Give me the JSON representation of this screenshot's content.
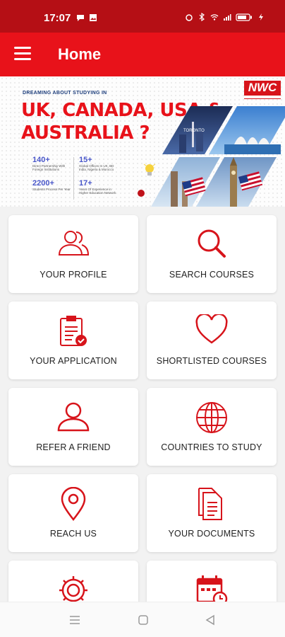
{
  "status": {
    "time": "17:07"
  },
  "header": {
    "title": "Home"
  },
  "banner": {
    "logo": "NWC",
    "tagline": "DREAMING ABOUT STUDYING IN",
    "headline_line1": "UK, CANADA, USA &",
    "headline_line2": "AUSTRALIA ?",
    "stats": [
      {
        "num": "140+",
        "label": "Direct Partnership With Foreign Institutions"
      },
      {
        "num": "15+",
        "label": "Global Offices In UK, BD India, Nigeria & Morocco"
      },
      {
        "num": "2200+",
        "label": "Students Process Per Year"
      },
      {
        "num": "17+",
        "label": "Years Of Experience in Higher Education Network"
      }
    ]
  },
  "menu": [
    {
      "label": "YOUR PROFILE",
      "icon": "users-icon"
    },
    {
      "label": "SEARCH COURSES",
      "icon": "search-icon"
    },
    {
      "label": "YOUR APPLICATION",
      "icon": "clipboard-check-icon"
    },
    {
      "label": "SHORTLISTED COURSES",
      "icon": "heart-icon"
    },
    {
      "label": "REFER A FRIEND",
      "icon": "user-icon"
    },
    {
      "label": "COUNTRIES TO STUDY",
      "icon": "globe-icon"
    },
    {
      "label": "REACH US",
      "icon": "location-pin-icon"
    },
    {
      "label": "YOUR DOCUMENTS",
      "icon": "documents-icon"
    },
    {
      "label": "",
      "icon": "gear-icon"
    },
    {
      "label": "",
      "icon": "calendar-clock-icon"
    }
  ],
  "colors": {
    "primary": "#e8121a",
    "status_bar": "#b50f15",
    "icon": "#d7141b"
  }
}
